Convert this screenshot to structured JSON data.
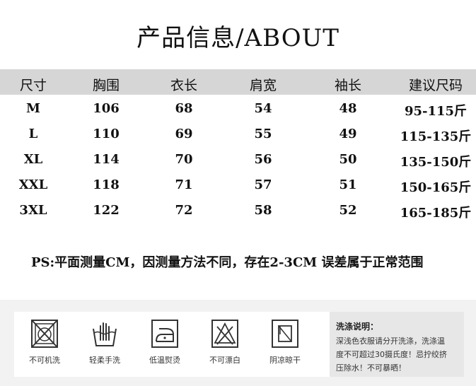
{
  "title": "产品信息/ABOUT",
  "size_table": {
    "headers": [
      "尺寸",
      "胸围",
      "衣长",
      "肩宽",
      "袖长",
      "建议尺码"
    ],
    "rows": [
      [
        "M",
        "106",
        "68",
        "54",
        "48",
        "95-115斤"
      ],
      [
        "L",
        "110",
        "69",
        "55",
        "49",
        "115-135斤"
      ],
      [
        "XL",
        "114",
        "70",
        "56",
        "50",
        "135-150斤"
      ],
      [
        "XXL",
        "118",
        "71",
        "57",
        "51",
        "150-165斤"
      ],
      [
        "3XL",
        "122",
        "72",
        "58",
        "52",
        "165-185斤"
      ]
    ]
  },
  "note": "PS:平面测量CM，因测量方法不同，存在2-3CM 误差属于正常范围",
  "care": {
    "symbols": [
      {
        "icon": "no-machine-wash-icon",
        "label": "不可机洗"
      },
      {
        "icon": "hand-wash-icon",
        "label": "轻柔手洗"
      },
      {
        "icon": "low-temp-iron-icon",
        "label": "低温熨烫"
      },
      {
        "icon": "no-bleach-icon",
        "label": "不可漂白"
      },
      {
        "icon": "shade-dry-icon",
        "label": "阴凉晾干"
      }
    ],
    "instructions": {
      "title": "洗涤说明：",
      "lines": [
        "深浅色衣服请分开洗涤，洗涤温",
        "度不可超过30摄氏度！忌拧绞挤",
        "压除水！不可暴晒！"
      ]
    }
  }
}
